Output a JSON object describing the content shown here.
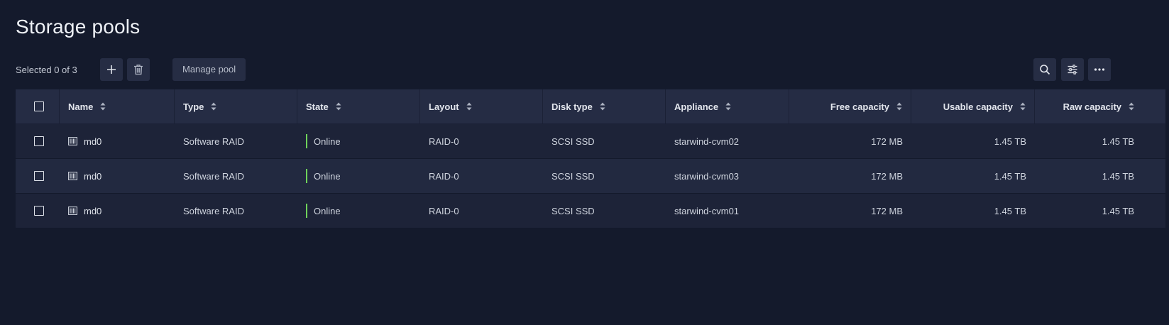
{
  "page": {
    "title": "Storage pools"
  },
  "toolbar": {
    "selected_text": "Selected 0 of 3",
    "add_icon": "plus-icon",
    "delete_icon": "trash-icon",
    "manage_pool_label": "Manage pool",
    "search_icon": "search-icon",
    "filter_icon": "sliders-icon",
    "more_icon": "ellipsis-icon"
  },
  "table": {
    "columns": [
      {
        "key": "name",
        "label": "Name"
      },
      {
        "key": "type",
        "label": "Type"
      },
      {
        "key": "state",
        "label": "State"
      },
      {
        "key": "layout",
        "label": "Layout"
      },
      {
        "key": "disk_type",
        "label": "Disk type"
      },
      {
        "key": "appliance",
        "label": "Appliance"
      },
      {
        "key": "free_capacity",
        "label": "Free capacity"
      },
      {
        "key": "usable_capacity",
        "label": "Usable capacity"
      },
      {
        "key": "raw_capacity",
        "label": "Raw capacity"
      }
    ],
    "rows": [
      {
        "name": "md0",
        "type": "Software RAID",
        "state": "Online",
        "layout": "RAID-0",
        "disk_type": "SCSI SSD",
        "appliance": "starwind-cvm02",
        "free_capacity": "172 MB",
        "usable_capacity": "1.45 TB",
        "raw_capacity": "1.45 TB"
      },
      {
        "name": "md0",
        "type": "Software RAID",
        "state": "Online",
        "layout": "RAID-0",
        "disk_type": "SCSI SSD",
        "appliance": "starwind-cvm03",
        "free_capacity": "172 MB",
        "usable_capacity": "1.45 TB",
        "raw_capacity": "1.45 TB"
      },
      {
        "name": "md0",
        "type": "Software RAID",
        "state": "Online",
        "layout": "RAID-0",
        "disk_type": "SCSI SSD",
        "appliance": "starwind-cvm01",
        "free_capacity": "172 MB",
        "usable_capacity": "1.45 TB",
        "raw_capacity": "1.45 TB"
      }
    ]
  },
  "colors": {
    "background": "#141a2c",
    "header_row": "#252c44",
    "row_dark": "#1d2338",
    "row_light": "#222940",
    "button_bg": "#262d44",
    "status_online": "#6fd35a"
  }
}
